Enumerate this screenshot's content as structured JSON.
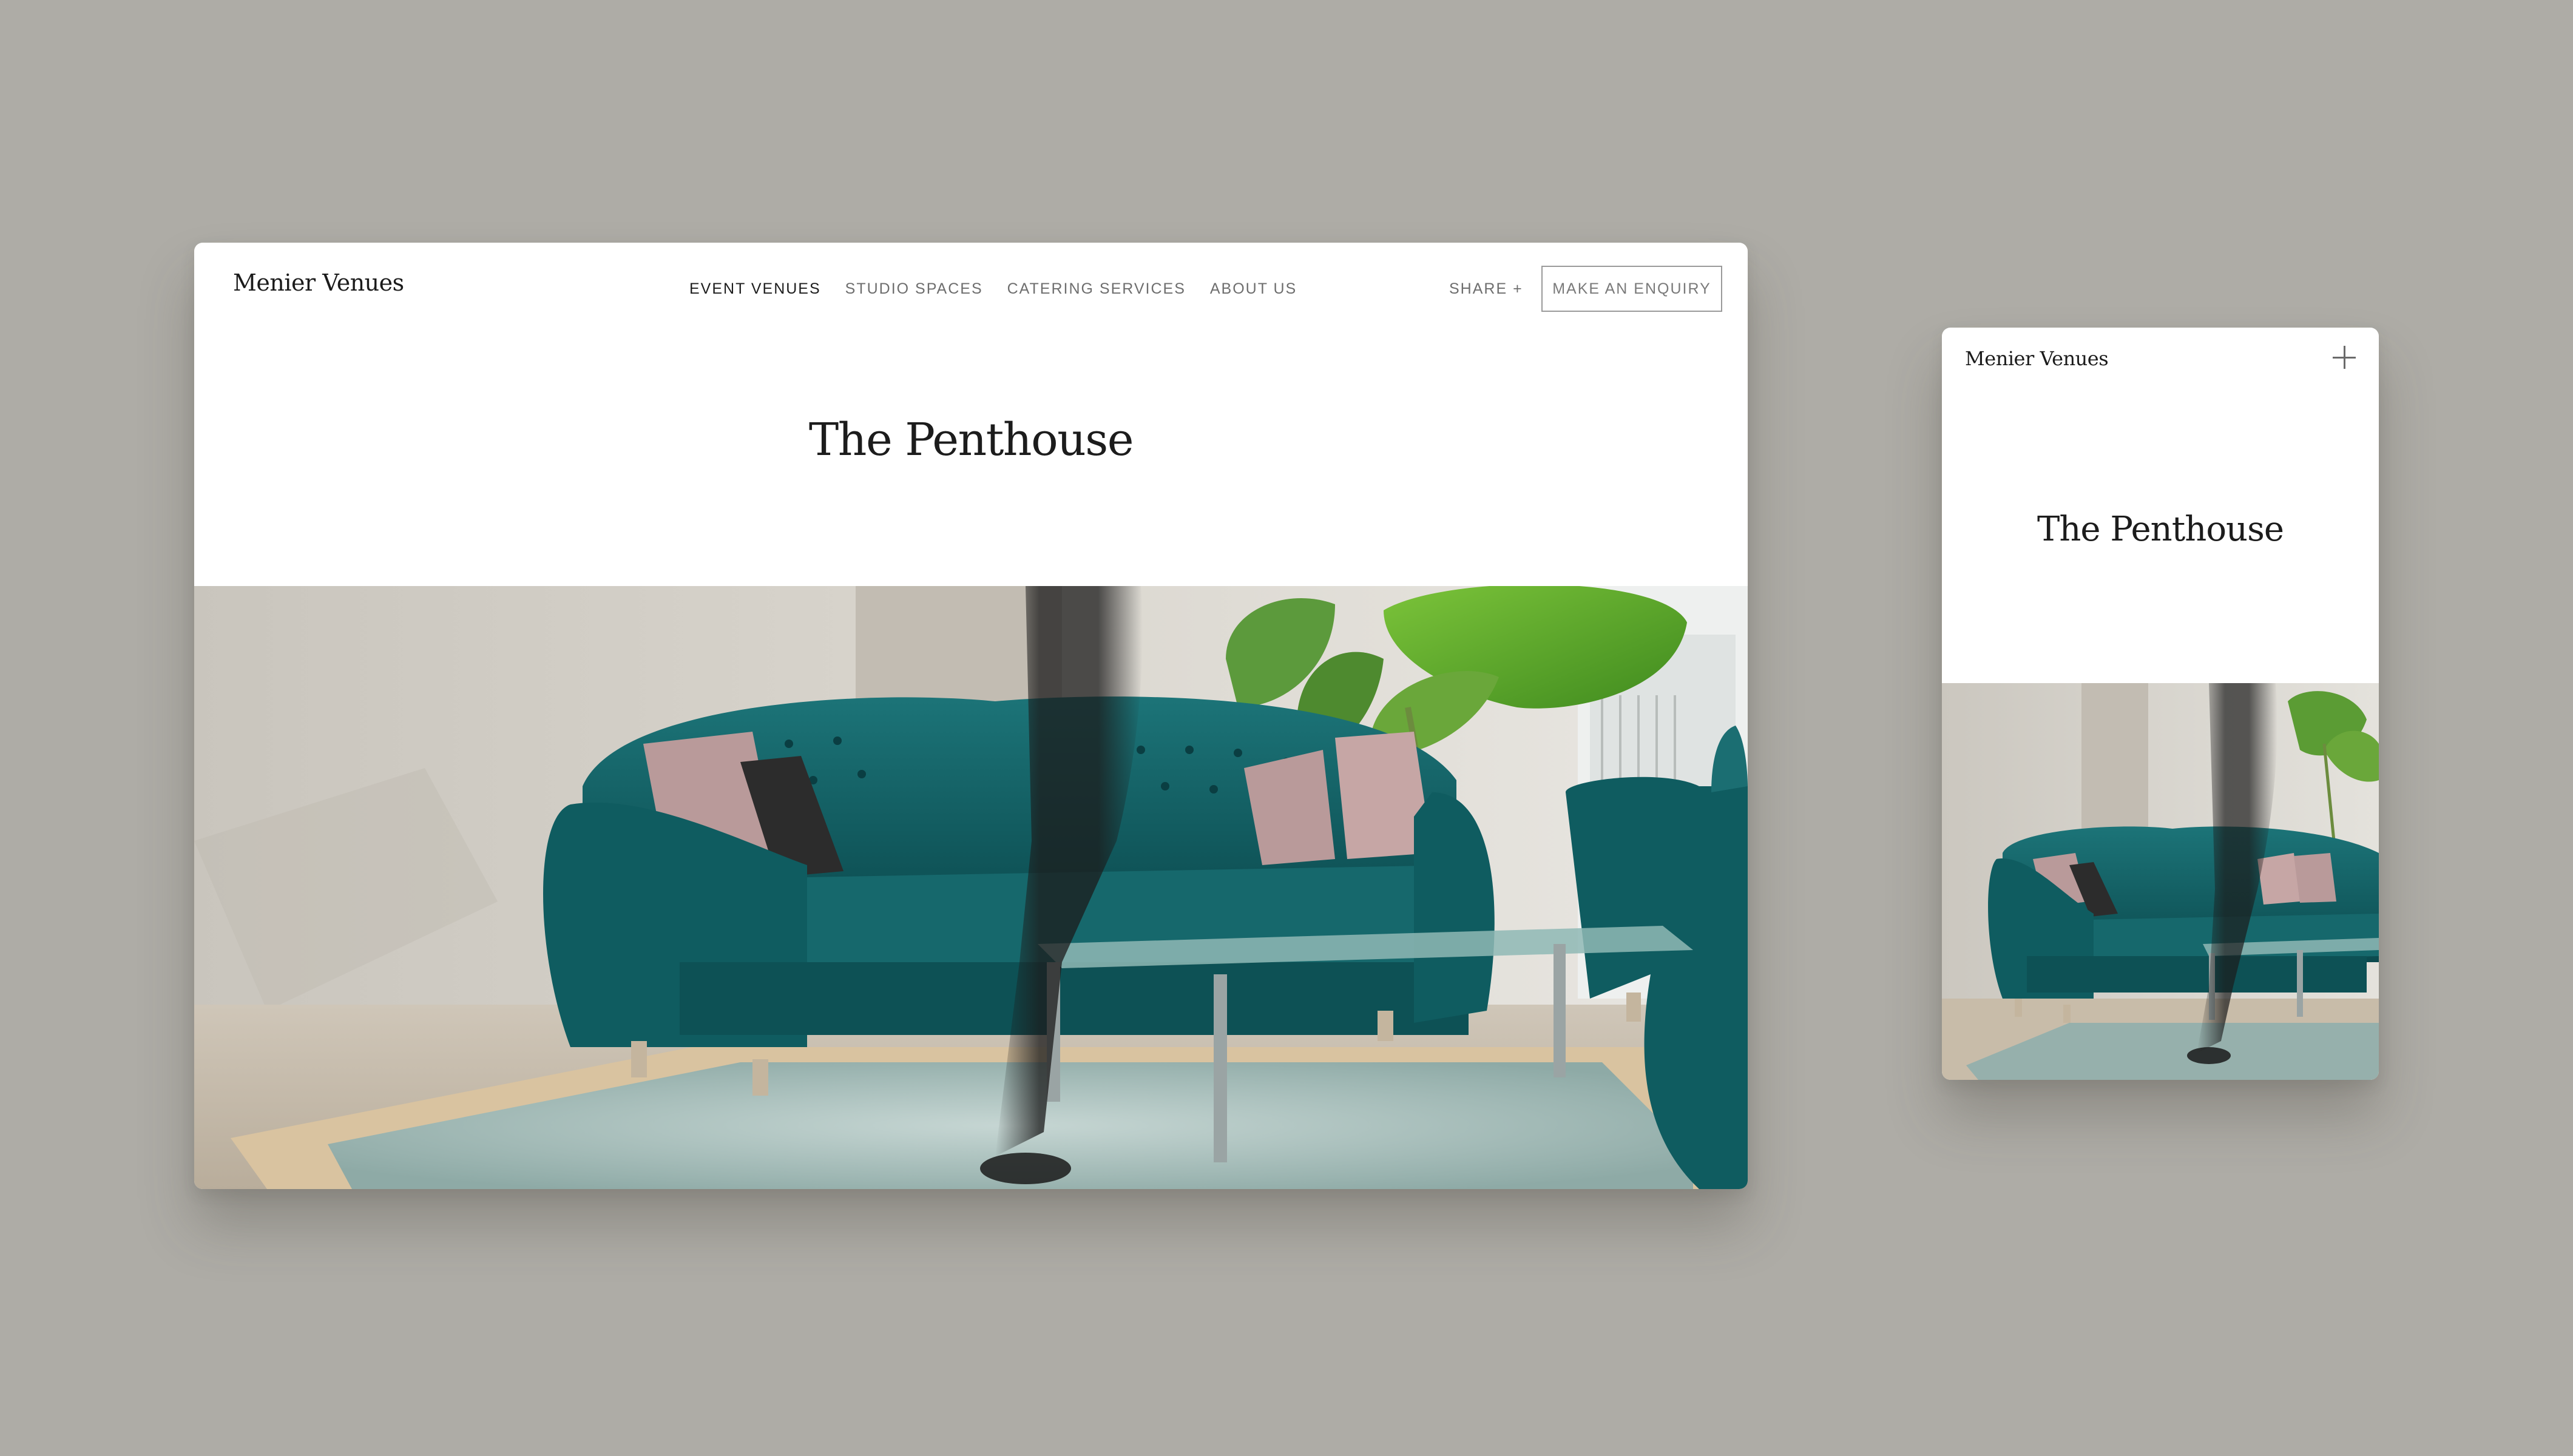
{
  "desktop": {
    "brand": "Menier Venues",
    "nav": {
      "items": [
        {
          "label": "EVENT VENUES",
          "active": true
        },
        {
          "label": "STUDIO SPACES",
          "active": false
        },
        {
          "label": "CATERING SERVICES",
          "active": false
        },
        {
          "label": "ABOUT US",
          "active": false
        }
      ],
      "share_label": "SHARE +",
      "enquiry_label": "MAKE AN ENQUIRY"
    },
    "page_title": "The Penthouse",
    "hero_image": "teal-tufted-sofa-lounge-photo"
  },
  "mobile": {
    "brand": "Menier Venues",
    "menu_icon": "plus-icon",
    "page_title": "The Penthouse",
    "hero_image": "teal-tufted-sofa-lounge-photo"
  },
  "colors": {
    "backdrop": "#aeaca6",
    "card": "#ffffff",
    "text": "#1c1c1c",
    "nav_muted": "#6e6e6e",
    "sofa_teal": "#0f5f63",
    "leaf_green": "#5aa62a"
  }
}
